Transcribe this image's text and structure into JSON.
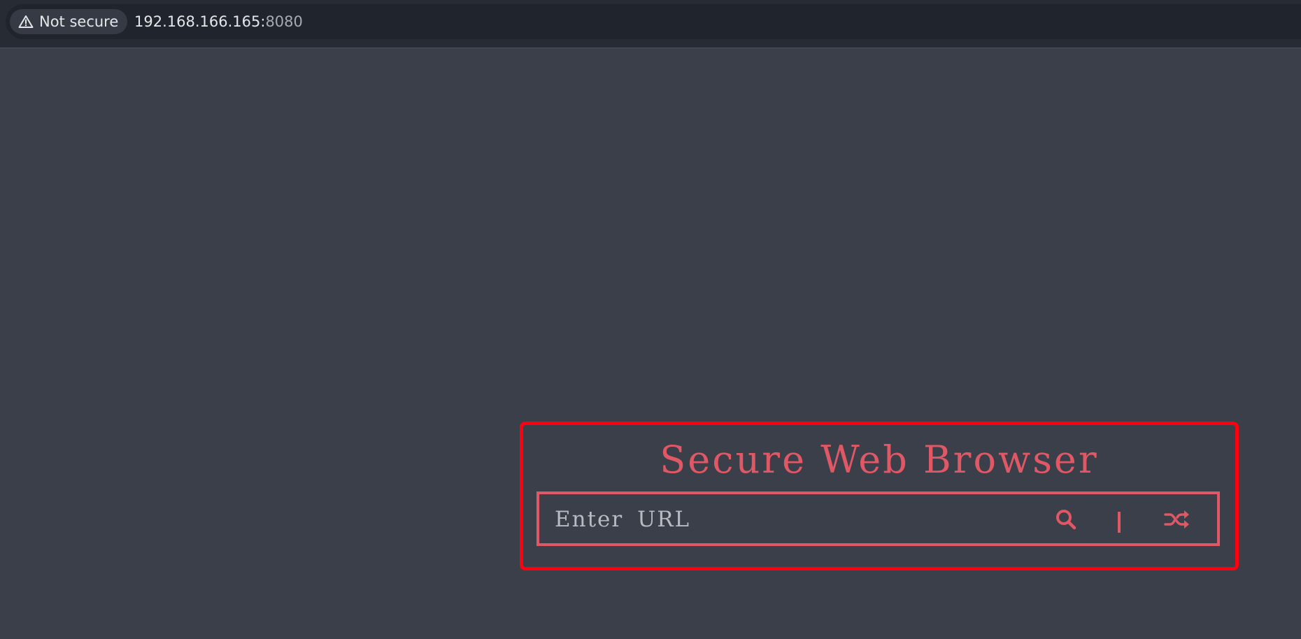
{
  "browser": {
    "security_label": "Not secure",
    "url_host": "192.168.166.165:",
    "url_port": "8080",
    "security_icon": "warning-triangle-icon"
  },
  "app": {
    "title": "Secure Web Browser",
    "url_placeholder": "Enter URL",
    "url_value": "",
    "search_icon": "search-icon",
    "divider_text": "|",
    "random_icon": "shuffle-icon",
    "accent_color": "#e05865",
    "highlight_color": "#ff0010"
  }
}
